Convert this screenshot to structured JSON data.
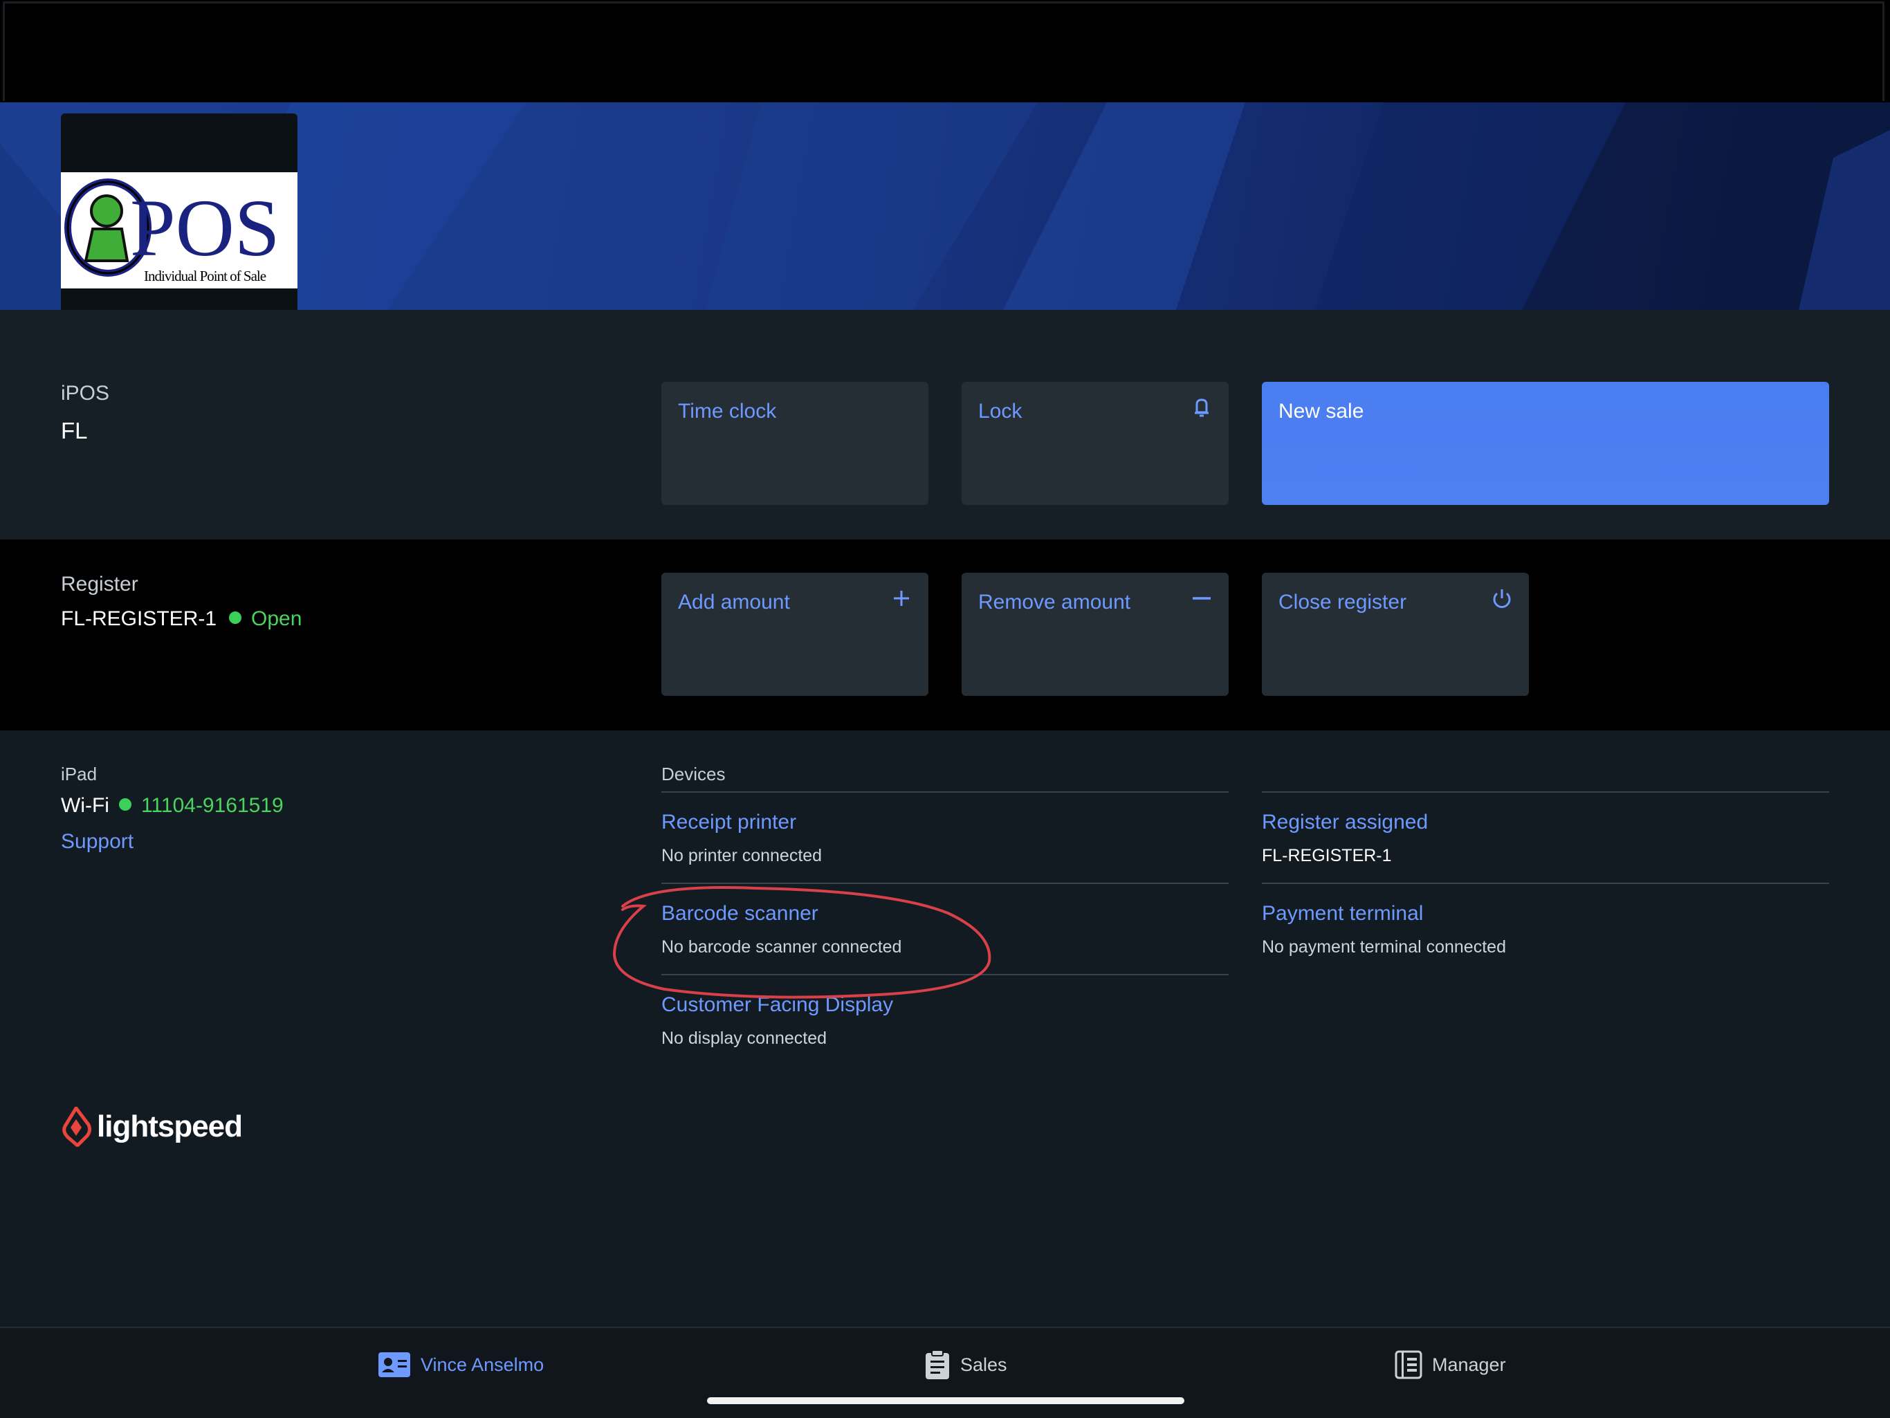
{
  "store": {
    "label": "iPOS",
    "code": "FL"
  },
  "logo": {
    "big_text": "POS",
    "tagline": "Individual Point of Sale"
  },
  "actions": {
    "time_clock": "Time clock",
    "lock": "Lock",
    "new_sale": "New sale"
  },
  "register": {
    "label": "Register",
    "name": "FL-REGISTER-1",
    "status": "Open",
    "status_color": "#3cd05a",
    "add_amount": "Add amount",
    "remove_amount": "Remove amount",
    "close_register": "Close register"
  },
  "device_info": {
    "label": "iPad",
    "wifi_label": "Wi-Fi",
    "wifi_network": "11104-9161519",
    "support": "Support"
  },
  "devices": {
    "heading": "Devices",
    "receipt_printer": {
      "title": "Receipt printer",
      "status": "No printer connected"
    },
    "barcode_scanner": {
      "title": "Barcode scanner",
      "status": "No barcode scanner connected"
    },
    "customer_display": {
      "title": "Customer Facing Display",
      "status": "No display connected"
    },
    "register_assigned": {
      "title": "Register assigned",
      "status": "FL-REGISTER-1"
    },
    "payment_terminal": {
      "title": "Payment terminal",
      "status": "No payment terminal connected"
    }
  },
  "brand": {
    "name": "lightspeed",
    "color": "#e8453c"
  },
  "tabs": {
    "user": "Vince Anselmo",
    "sales": "Sales",
    "manager": "Manager"
  },
  "colors": {
    "accent": "#6e99ff",
    "primary_button": "#4f80f2",
    "annotation": "#d8404a"
  }
}
